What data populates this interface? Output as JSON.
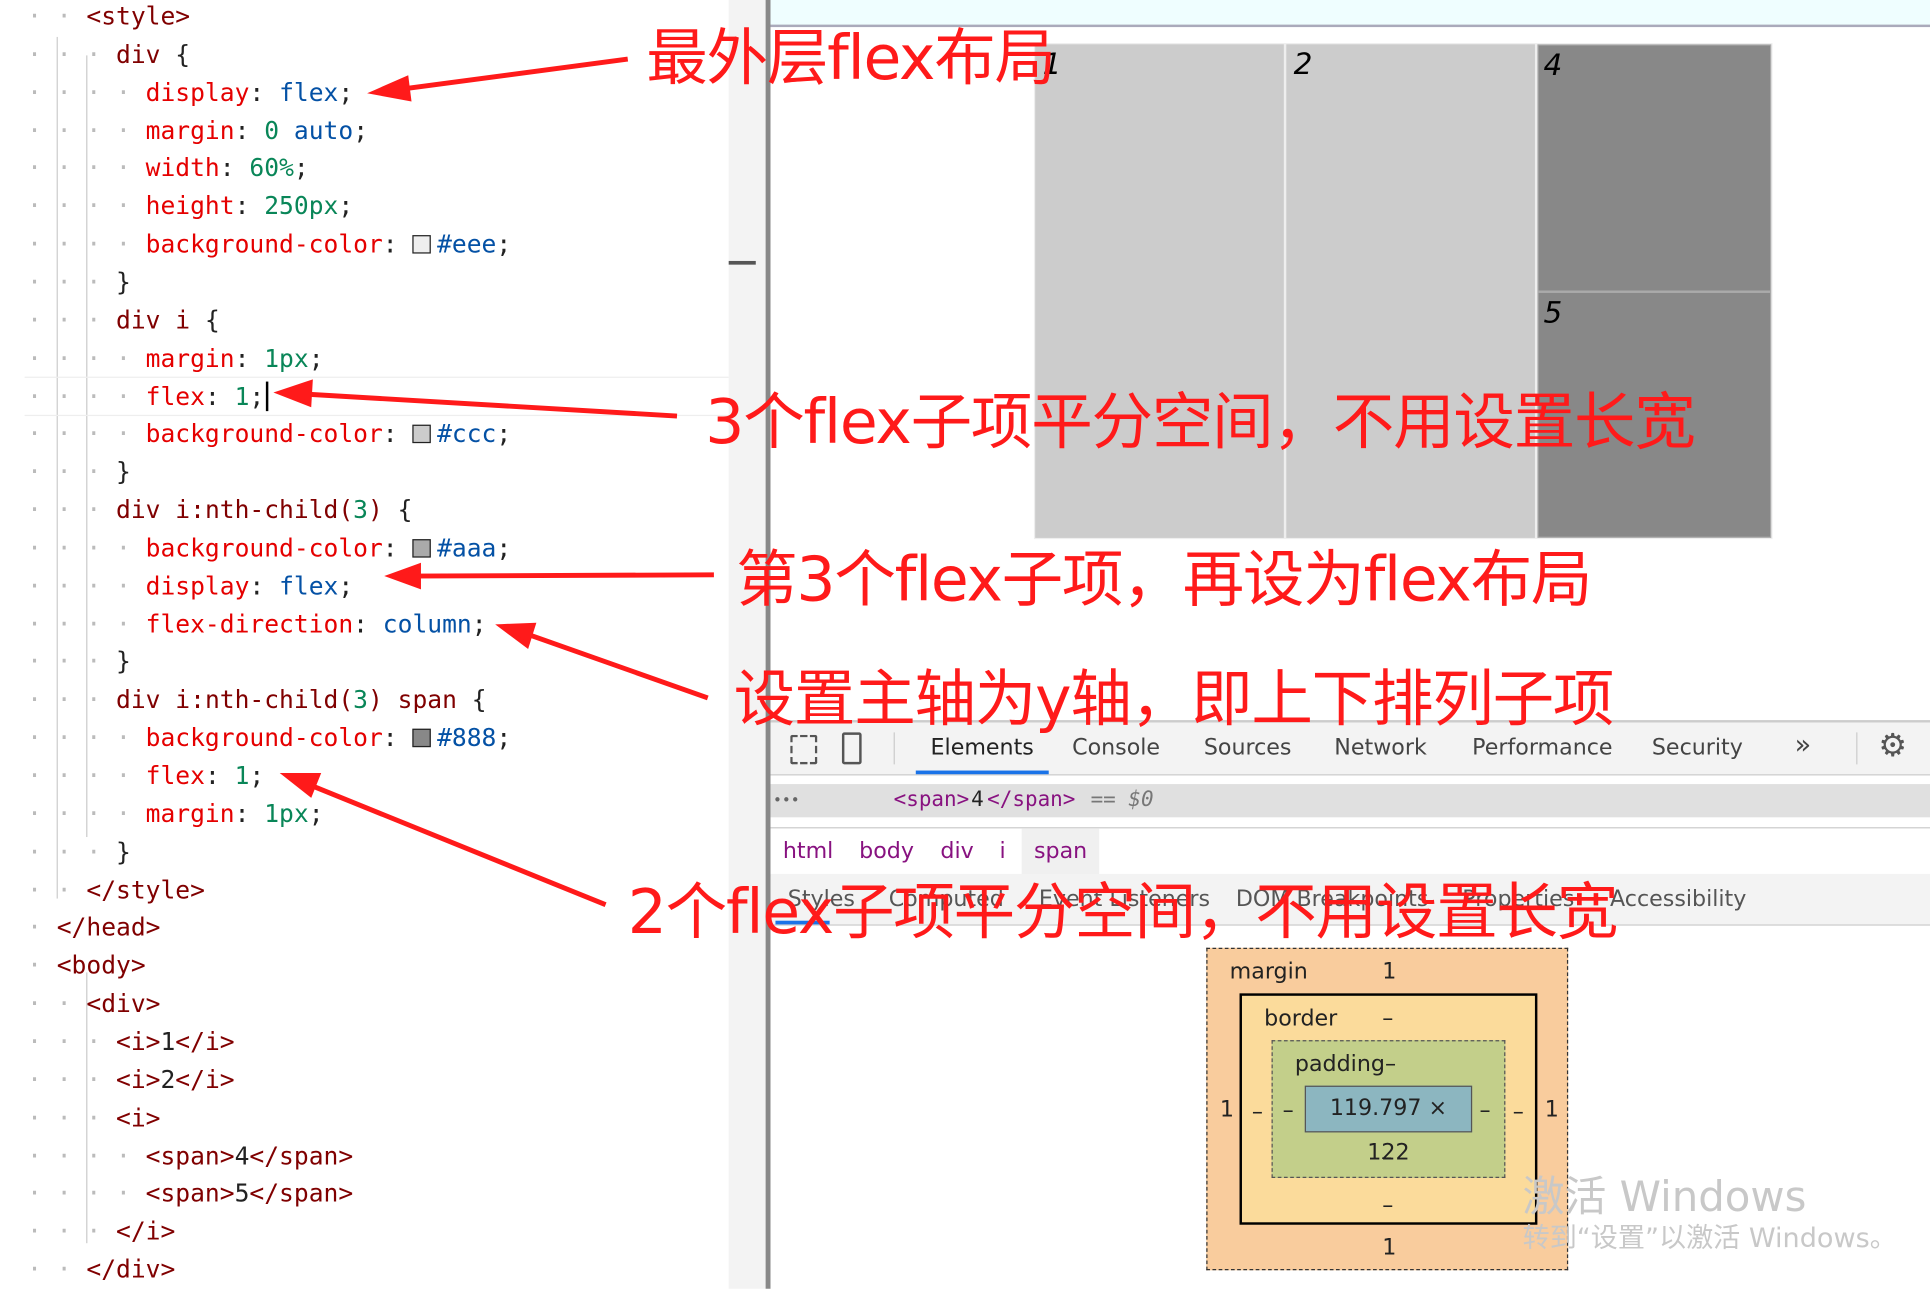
{
  "code_lines": [
    {
      "indent": 2,
      "html": "<span class='tg'>&lt;style&gt;</span>"
    },
    {
      "indent": 3,
      "html": "<span class='sel'>div</span> {"
    },
    {
      "indent": 4,
      "html": "<span class='pr'>display</span>: <span class='vb'>flex</span>;"
    },
    {
      "indent": 4,
      "html": "<span class='pr'>margin</span>: <span class='vn'>0</span> <span class='vb'>auto</span>;"
    },
    {
      "indent": 4,
      "html": "<span class='pr'>width</span>: <span class='vn'>60%</span>;"
    },
    {
      "indent": 4,
      "html": "<span class='pr'>height</span>: <span class='vn'>250px</span>;"
    },
    {
      "indent": 4,
      "html": "<span class='pr'>background-color</span>: <span class='sw' style='background:#eee'></span><span class='vb'>#eee</span>;"
    },
    {
      "indent": 3,
      "html": "}"
    },
    {
      "indent": 3,
      "html": "<span class='sel'>div i</span> {"
    },
    {
      "indent": 4,
      "html": "<span class='pr'>margin</span>: <span class='vn'>1px</span>;"
    },
    {
      "indent": 4,
      "html": "<span class='pr'>flex</span>: <span class='vn'>1</span>;|"
    },
    {
      "indent": 4,
      "html": "<span class='pr'>background-color</span>: <span class='sw' style='background:#ccc'></span><span class='vb'>#ccc</span>;"
    },
    {
      "indent": 3,
      "html": "}"
    },
    {
      "indent": 3,
      "html": "<span class='sel'>div i:nth-child(</span><span class='vn'>3</span><span class='sel'>)</span> {"
    },
    {
      "indent": 4,
      "html": "<span class='pr'>background-color</span>: <span class='sw' style='background:#aaa'></span><span class='vb'>#aaa</span>;"
    },
    {
      "indent": 4,
      "html": "<span class='pr'>display</span>: <span class='vb'>flex</span>;"
    },
    {
      "indent": 4,
      "html": "<span class='pr'>flex-direction</span>: <span class='vb'>column</span>;"
    },
    {
      "indent": 3,
      "html": "}"
    },
    {
      "indent": 3,
      "html": "<span class='sel'>div i:nth-child(</span><span class='vn'>3</span><span class='sel'>) span</span> {"
    },
    {
      "indent": 4,
      "html": "<span class='pr'>background-color</span>: <span class='sw' style='background:#888'></span><span class='vb'>#888</span>;"
    },
    {
      "indent": 4,
      "html": "<span class='pr'>flex</span>: <span class='vn'>1</span>;"
    },
    {
      "indent": 4,
      "html": "<span class='pr'>margin</span>: <span class='vn'>1px</span>;"
    },
    {
      "indent": 3,
      "html": "}"
    },
    {
      "indent": 2,
      "html": "<span class='tg'>&lt;/style&gt;</span>"
    },
    {
      "indent": 1,
      "html": "<span class='tg'>&lt;/head&gt;</span>"
    },
    {
      "indent": 1,
      "html": "<span class='tg'>&lt;body&gt;</span>"
    },
    {
      "indent": 2,
      "html": "<span class='tg'>&lt;div&gt;</span>"
    },
    {
      "indent": 3,
      "html": "<span class='tg'>&lt;i&gt;</span>1<span class='tg'>&lt;/i&gt;</span>"
    },
    {
      "indent": 3,
      "html": "<span class='tg'>&lt;i&gt;</span>2<span class='tg'>&lt;/i&gt;</span>"
    },
    {
      "indent": 3,
      "html": "<span class='tg'>&lt;i&gt;</span>"
    },
    {
      "indent": 4,
      "html": "<span class='tg'>&lt;span&gt;</span>4<span class='tg'>&lt;/span&gt;</span>"
    },
    {
      "indent": 4,
      "html": "<span class='tg'>&lt;span&gt;</span>5<span class='tg'>&lt;/span&gt;</span>"
    },
    {
      "indent": 3,
      "html": "<span class='tg'>&lt;/i&gt;</span>"
    },
    {
      "indent": 2,
      "html": "<span class='tg'>&lt;/div&gt;</span>"
    }
  ],
  "preview": {
    "item1": "1",
    "item2": "2",
    "item4": "4",
    "item5": "5"
  },
  "devtools": {
    "tabs": [
      "Elements",
      "Console",
      "Sources",
      "Network",
      "Performance",
      "Security"
    ],
    "more": "»",
    "selected_prefix": "•••",
    "selected_open": "<span>",
    "selected_text": "4",
    "selected_close": "</span>",
    "selected_suffix": "== $0",
    "breadcrumbs": [
      "html",
      "body",
      "div",
      "i",
      "span"
    ],
    "subtabs": [
      "Styles",
      "Computed",
      "Event Listeners",
      "DOM Breakpoints",
      "Properties",
      "Accessibility"
    ],
    "box_model": {
      "margin_label": "margin",
      "margin_top": "1",
      "margin_left": "1",
      "margin_right": "1",
      "margin_bottom": "1",
      "border_label": "border",
      "border_top": "–",
      "border_left": "–",
      "border_right": "–",
      "border_bottom": "–",
      "padding_label": "padding–",
      "padding_left": "–",
      "padding_right": "–",
      "padding_bottom": "–",
      "content": "119.797 × 122"
    }
  },
  "annotations": [
    "最外层flex布局",
    "3个flex子项平分空间，不用设置长宽",
    "第3个flex子项，再设为flex布局",
    "设置主轴为y轴，即上下排列子项",
    "2个flex子项平分空间，不用设置长宽"
  ],
  "watermark": {
    "line1": "激活 Windows",
    "line2": "转到“设置”以激活 Windows。"
  },
  "colors": {
    "annotation": "#ff1a1a",
    "active_tab": "#1a73e8"
  }
}
